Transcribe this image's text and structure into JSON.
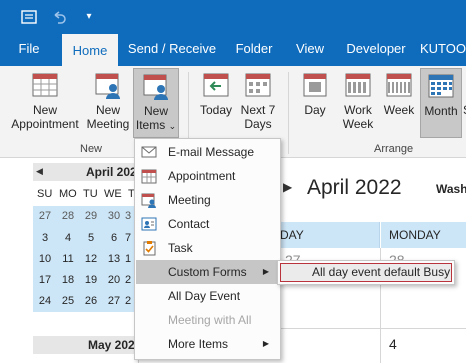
{
  "titlebar": {
    "icons": [
      "app-menu-icon",
      "undo-icon",
      "customize-qat-icon"
    ]
  },
  "tabs": [
    {
      "label": "File"
    },
    {
      "label": "Home"
    },
    {
      "label": "Send / Receive"
    },
    {
      "label": "Folder"
    },
    {
      "label": "View"
    },
    {
      "label": "Developer"
    },
    {
      "label": "KUTOO"
    }
  ],
  "ribbon": {
    "new_appointment": "New\nAppointment",
    "new_appointment_l1": "New",
    "new_appointment_l2": "Appointment",
    "new_meeting_l1": "New",
    "new_meeting_l2": "Meeting",
    "new_items_l1": "New",
    "new_items_l2": "Items",
    "new_items_caret": "⌄",
    "today": "Today",
    "next7_l1": "Next 7",
    "next7_l2": "Days",
    "day": "Day",
    "work_week_l1": "Work",
    "work_week_l2": "Week",
    "week": "Week",
    "month": "Month",
    "schedule_partial": "S",
    "group_new": "New",
    "group_arrange": "Arrange",
    "group_goto_partial": "o"
  },
  "mini_calendar": {
    "prev_arrow": "◀",
    "title": "April 2022",
    "dow": [
      "SU",
      "MO",
      "TU",
      "WE",
      "T"
    ],
    "weeks": [
      [
        "27",
        "28",
        "29",
        "30",
        "3"
      ],
      [
        "3",
        "4",
        "5",
        "6",
        "7"
      ],
      [
        "10",
        "11",
        "12",
        "13",
        "1"
      ],
      [
        "17",
        "18",
        "19",
        "20",
        "2"
      ],
      [
        "24",
        "25",
        "26",
        "27",
        "2"
      ]
    ],
    "next_title": "May 2022"
  },
  "calendar_view": {
    "nav_arrow": "▶",
    "title": "April 2022",
    "location": "Washi",
    "columns": [
      "DAY",
      "MONDAY"
    ],
    "cell_numbers": [
      "27",
      "28",
      "4"
    ]
  },
  "menu": {
    "items": [
      {
        "label": "E-mail Message",
        "icon": "email-icon",
        "enabled": true
      },
      {
        "label": "Appointment",
        "icon": "appointment-icon",
        "enabled": true
      },
      {
        "label": "Meeting",
        "icon": "meeting-icon",
        "enabled": true
      },
      {
        "label": "Contact",
        "icon": "contact-icon",
        "enabled": true
      },
      {
        "label": "Task",
        "icon": "task-icon",
        "enabled": true
      },
      {
        "label": "Custom Forms",
        "icon": "",
        "enabled": true,
        "submenu": true
      },
      {
        "label": "All Day Event",
        "icon": "",
        "enabled": true
      },
      {
        "label": "Meeting with All",
        "icon": "",
        "enabled": false
      },
      {
        "label": "More Items",
        "icon": "",
        "enabled": true,
        "submenu": true
      }
    ],
    "submenu_arrow": "▶"
  },
  "submenu": {
    "item": "All day event default Busy"
  },
  "colors": {
    "accent": "#0f6cbd",
    "highlight": "#cde6f7",
    "selection_border": "#b8333c"
  }
}
